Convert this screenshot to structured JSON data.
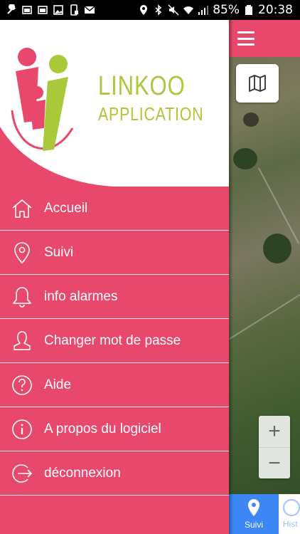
{
  "status_bar": {
    "battery": "85%",
    "time": "20:38"
  },
  "brand": {
    "line1": "LINKOO",
    "line2": "APPLICATION"
  },
  "menu": {
    "items": [
      {
        "label": "Accueil",
        "icon": "home-icon"
      },
      {
        "label": "Suivi",
        "icon": "location-pin-icon"
      },
      {
        "label": "info alarmes",
        "icon": "bell-icon"
      },
      {
        "label": "Changer mot de passe",
        "icon": "user-icon"
      },
      {
        "label": "Aide",
        "icon": "help-circle-icon"
      },
      {
        "label": "A propos du logiciel",
        "icon": "info-circle-icon"
      },
      {
        "label": "déconnexion",
        "icon": "logout-icon"
      }
    ]
  },
  "map": {
    "zoom_in": "+",
    "zoom_out": "−"
  },
  "bottom_nav": {
    "active_label": "Suivi",
    "second_label": "Hist"
  },
  "colors": {
    "accent": "#e8486c",
    "brand_green": "#a9c93b",
    "nav_blue": "#3d86f5"
  }
}
